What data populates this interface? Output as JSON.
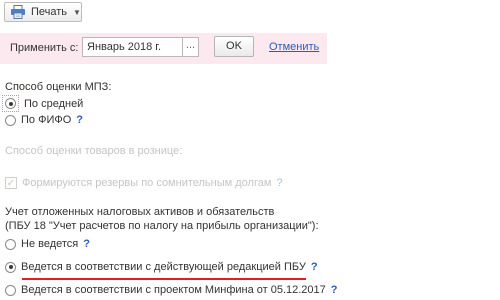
{
  "toolbar": {
    "print_label": "Печать",
    "print_icon": "printer-icon"
  },
  "apply": {
    "label": "Применить с:",
    "date_value": "Январь 2018 г.",
    "date_picker_glyph": "...",
    "ok_label": "OK",
    "cancel_label": "Отменить"
  },
  "mpz": {
    "title": "Способ оценки МПЗ:",
    "options": [
      {
        "label": "По средней",
        "checked": true
      },
      {
        "label": "По ФИФО",
        "checked": false,
        "help": "?"
      }
    ]
  },
  "retail": {
    "title": "Способ оценки товаров в рознице:"
  },
  "reserves": {
    "label": "Формируются резервы по сомнительным долгам",
    "help": "?"
  },
  "deferred": {
    "title_line1": "Учет отложенных налоговых активов и обязательств",
    "title_line2": "(ПБУ 18 \"Учет расчетов по налогу на прибыль организации\"):",
    "options": [
      {
        "label": "Не ведется",
        "checked": false,
        "help": "?"
      },
      {
        "label": "Ведется в соответствии с действующей редакцией ПБУ",
        "checked": true,
        "help": "?"
      },
      {
        "label": "Ведется в соответствии с проектом Минфина от 05.12.2017",
        "checked": false,
        "help": "?"
      }
    ]
  },
  "colors": {
    "accent_link": "#2a5bb8",
    "panel_bg": "#fbe9ef",
    "underline": "#e02020"
  }
}
